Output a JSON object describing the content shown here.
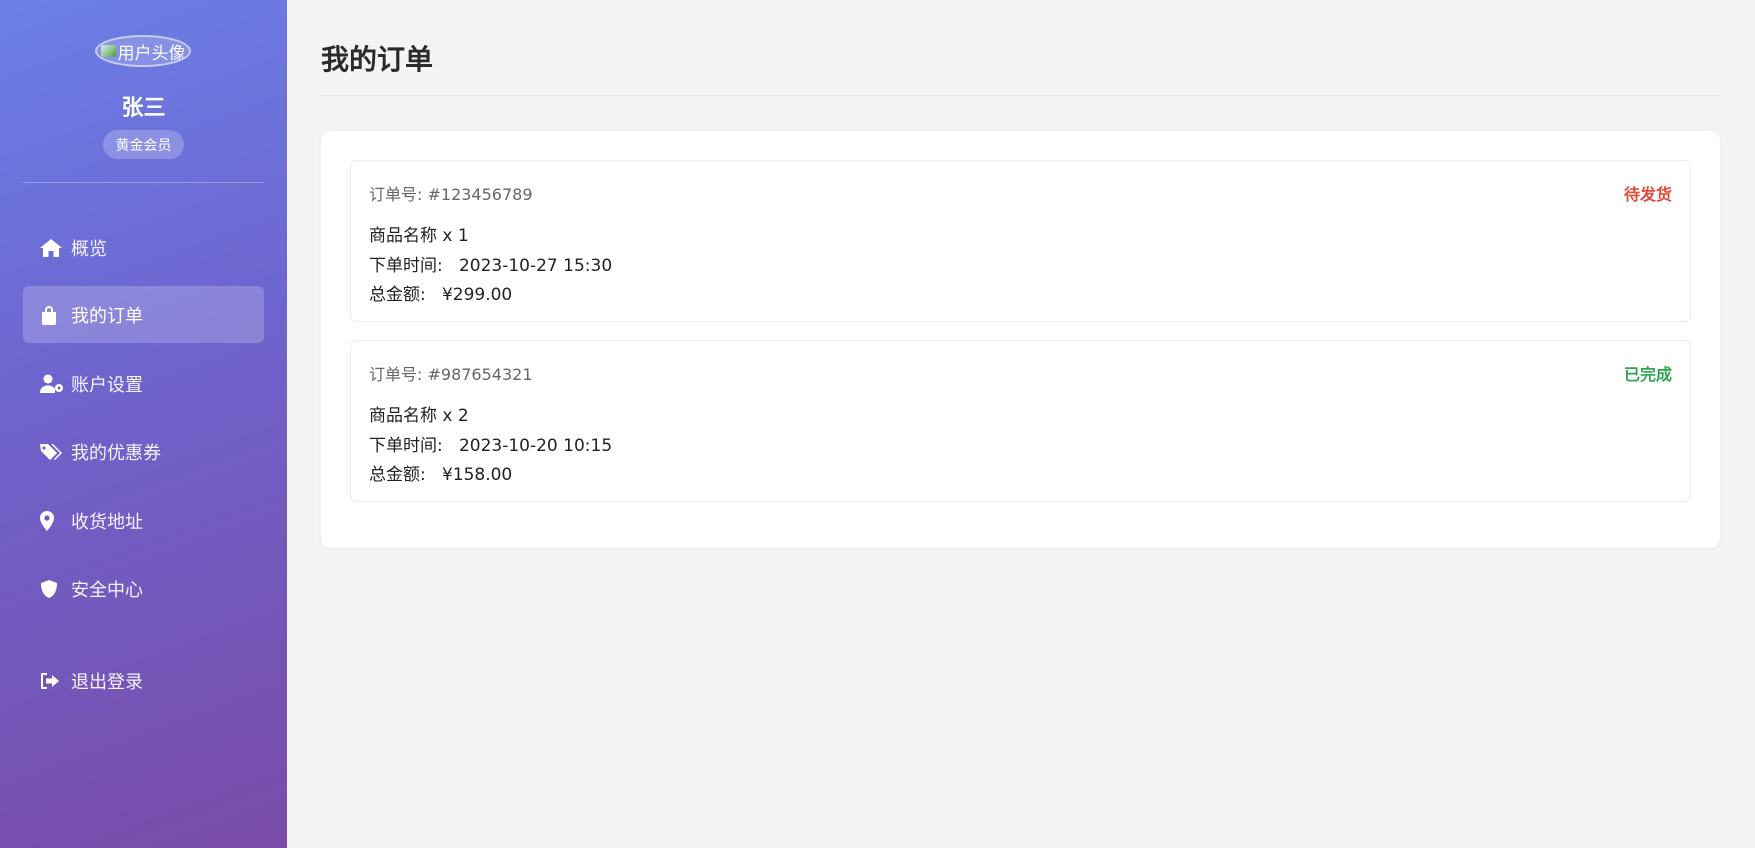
{
  "sidebar": {
    "avatar_alt": "用户头像",
    "user_name": "张三",
    "member_level": "黄金会员",
    "nav": [
      {
        "label": "概览",
        "icon": "home-icon"
      },
      {
        "label": "我的订单",
        "icon": "shopping-bag-icon",
        "active": true
      },
      {
        "label": "账户设置",
        "icon": "user-cog-icon"
      },
      {
        "label": "我的优惠券",
        "icon": "tags-icon"
      },
      {
        "label": "收货地址",
        "icon": "map-marker-icon"
      },
      {
        "label": "安全中心",
        "icon": "shield-icon"
      },
      {
        "label": "退出登录",
        "icon": "sign-out-icon"
      }
    ]
  },
  "main": {
    "title": "我的订单",
    "orders": [
      {
        "order_no": "订单号: #123456789",
        "status": "待发货",
        "status_color": "#e04b3a",
        "product": "商品名称 x 1",
        "time_label": "下单时间:",
        "time": "2023-10-27 15:30",
        "total_label": "总金额:",
        "total": "¥299.00"
      },
      {
        "order_no": "订单号: #987654321",
        "status": "已完成",
        "status_color": "#2ea44f",
        "product": "商品名称 x 2",
        "time_label": "下单时间:",
        "time": "2023-10-20 10:15",
        "total_label": "总金额:",
        "total": "¥158.00"
      }
    ]
  },
  "colors": {
    "sidebar_gradient_start": "#6a80e8",
    "sidebar_gradient_end": "#7a4ba8",
    "background": "#f4f4f4"
  }
}
